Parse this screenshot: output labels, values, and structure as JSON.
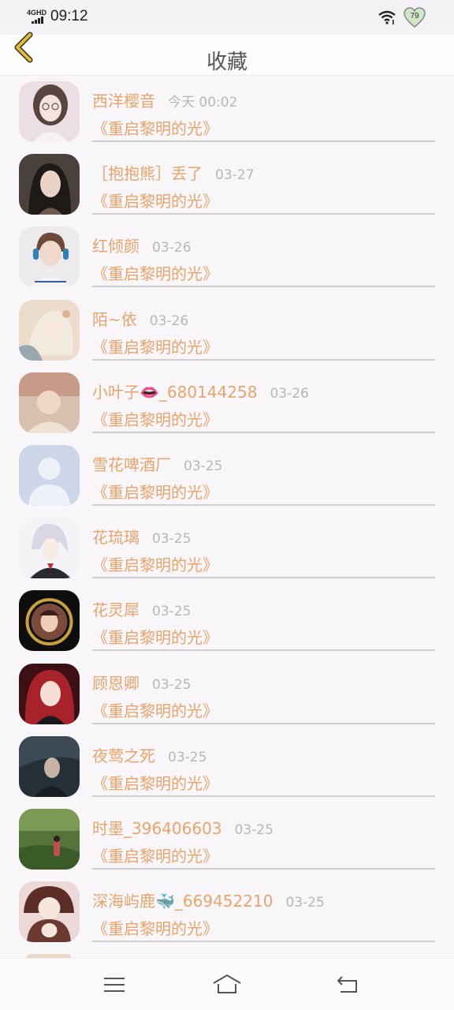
{
  "status_bar": {
    "network": "4GHD",
    "time": "09:12",
    "battery": "79"
  },
  "header": {
    "title": "收藏"
  },
  "items": [
    {
      "name": "西洋樱音",
      "time": "今天 00:02",
      "book": "《重启黎明的光》",
      "avatar_color": "#e9dde2"
    },
    {
      "name": "［抱抱熊］丢了",
      "time": "03-27",
      "book": "《重启黎明的光》",
      "avatar_color": "#3a3330"
    },
    {
      "name": "红倾颜",
      "time": "03-26",
      "book": "《重启黎明的光》",
      "avatar_color": "#e7e4e6"
    },
    {
      "name": "陌~依",
      "time": "03-26",
      "book": "《重启黎明的光》",
      "avatar_color": "#e8d9c7"
    },
    {
      "name": "小叶子👄_680144258",
      "time": "03-26",
      "book": "《重启黎明的光》",
      "avatar_color": "#d8c0b0"
    },
    {
      "name": "雪花啤酒厂",
      "time": "03-25",
      "book": "《重启黎明的光》",
      "avatar_color": "#ccd6e8"
    },
    {
      "name": "花琉璃",
      "time": "03-25",
      "book": "《重启黎明的光》",
      "avatar_color": "#f0f0f4"
    },
    {
      "name": "花灵犀",
      "time": "03-25",
      "book": "《重启黎明的光》",
      "avatar_color": "#111111"
    },
    {
      "name": "顾恩卿",
      "time": "03-25",
      "book": "《重启黎明的光》",
      "avatar_color": "#4a1518"
    },
    {
      "name": "夜莺之死",
      "time": "03-25",
      "book": "《重启黎明的光》",
      "avatar_color": "#2a3038"
    },
    {
      "name": "时墨_396406603",
      "time": "03-25",
      "book": "《重启黎明的光》",
      "avatar_color": "#4f6a35"
    },
    {
      "name": "深海屿鹿🐳_669452210",
      "time": "03-25",
      "book": "《重启黎明的光》",
      "avatar_color": "#e8d4d2"
    }
  ],
  "colors": {
    "accent": "#e7a46d",
    "time": "#b7b7b7",
    "back_arrow": "#e2be3c"
  },
  "icons": {
    "back": "chevron-left-icon",
    "menu": "menu-icon",
    "home": "home-icon",
    "return": "return-icon"
  }
}
